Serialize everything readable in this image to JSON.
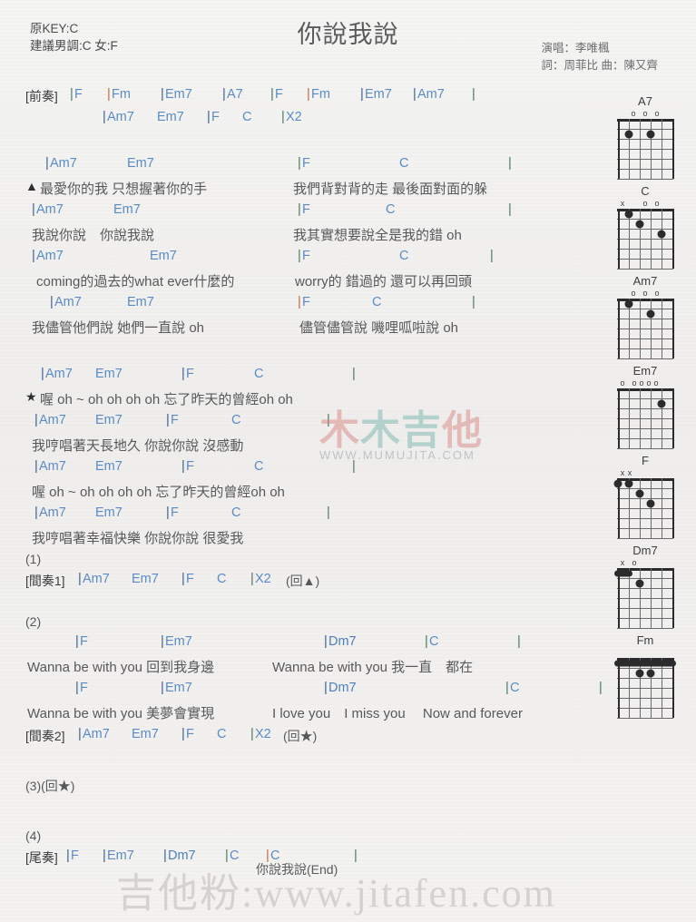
{
  "header": {
    "key_original": "原KEY:C",
    "key_suggested": "建議男調:C 女:F",
    "title": "你說我說",
    "singer": "演唱：李唯楓",
    "writers": "詞：周菲比  曲：陳又齊"
  },
  "sections": {
    "intro_label": "[前奏]",
    "interlude1_label": "[間奏1]",
    "interlude2_label": "[間奏2]",
    "outro_label": "[尾奏]",
    "num1": "(1)",
    "num2": "(2)",
    "num3": "(3)(回★)",
    "num4": "(4)",
    "repeat_triangle": "(回▲)",
    "repeat_star": "(回★)",
    "end_label": "你說我說(End)"
  },
  "chords": {
    "F": "F",
    "Fm": "Fm",
    "Em7": "Em7",
    "A7": "A7",
    "Am7": "Am7",
    "C": "C",
    "Dm7": "Dm7",
    "X2": "X2",
    "bar": "|"
  },
  "lyrics": {
    "v1a_left": "最愛你的我 只想握著你的手",
    "v1a_right": "我們背對背的走 最後面對面的躲",
    "v1b_left": "我說你說　你說我說",
    "v1b_right": "我其實想要說全是我的錯 oh",
    "v1c_left": "coming的過去的what ever什麼的",
    "v1c_right": "worry的 錯過的 還可以再回頭",
    "v1d_left": "我儘管他們說 她們一直說 oh",
    "v1d_right": "儘管儘管說 嘰哩呱啦說 oh",
    "ch1": "喔 oh ~ oh oh oh oh 忘了昨天的曾經oh oh",
    "ch2": "我哼唱著天長地久 你說你說 沒感動",
    "ch3": "喔 oh ~ oh oh oh oh 忘了昨天的曾經oh oh",
    "ch4": "我哼唱著幸福快樂 你說你說 很愛我",
    "br1_left": "Wanna be with you 回到我身邊",
    "br1_right": "Wanna be with you 我一直　都在",
    "br2_left": "Wanna be with you 美夢會實現",
    "br2_right": "I love you　I miss you　 Now and forever"
  },
  "markers": {
    "triangle": "▲",
    "star": "★"
  },
  "diagrams": [
    {
      "name": "A7",
      "open": [
        "o",
        "o",
        "o"
      ],
      "open_x": [
        18,
        31,
        44
      ],
      "dots": [
        [
          2,
          3
        ],
        [
          2,
          5
        ]
      ],
      "barres": [],
      "mutes": []
    },
    {
      "name": "C",
      "open": [
        "x",
        "o",
        "o"
      ],
      "open_x": [
        6,
        31,
        44
      ],
      "dots": [
        [
          1,
          5
        ],
        [
          2,
          4
        ],
        [
          3,
          2
        ]
      ],
      "barres": [],
      "mutes": []
    },
    {
      "name": "Am7",
      "open": [
        "o",
        "o",
        "o"
      ],
      "open_x": [
        18,
        31,
        44
      ],
      "dots": [
        [
          1,
          5
        ],
        [
          2,
          3
        ]
      ],
      "barres": [],
      "mutes": []
    },
    {
      "name": "Em7",
      "open": [
        "o",
        "o",
        "o",
        "o",
        "o"
      ],
      "open_x": [
        6,
        19,
        27,
        35,
        43
      ],
      "dots": [
        [
          2,
          2
        ]
      ],
      "barres": [],
      "mutes": []
    },
    {
      "name": "F",
      "open": [
        "x",
        "x"
      ],
      "open_x": [
        6,
        14
      ],
      "dots": [
        [
          1,
          6
        ],
        [
          1,
          5
        ],
        [
          2,
          4
        ],
        [
          3,
          3
        ]
      ],
      "barres": [],
      "mutes": []
    },
    {
      "name": "Dm7",
      "open": [
        "x",
        "o"
      ],
      "open_x": [
        6,
        19
      ],
      "dots": [
        [
          2,
          4
        ]
      ],
      "barres": [
        [
          1,
          5,
          6
        ]
      ],
      "mutes": []
    },
    {
      "name": "Fm",
      "open": [],
      "open_x": [],
      "dots": [
        [
          2,
          3
        ],
        [
          2,
          4
        ]
      ],
      "barres": [
        [
          1,
          1,
          6
        ]
      ],
      "mutes": []
    }
  ],
  "watermarks": {
    "mid_cn_1": "木",
    "mid_cn_2": "木吉",
    "mid_cn_3": "他",
    "mid_url": "WWW.MUMUJITA.COM",
    "bottom": "吉他粉:www.jitafen.com"
  }
}
